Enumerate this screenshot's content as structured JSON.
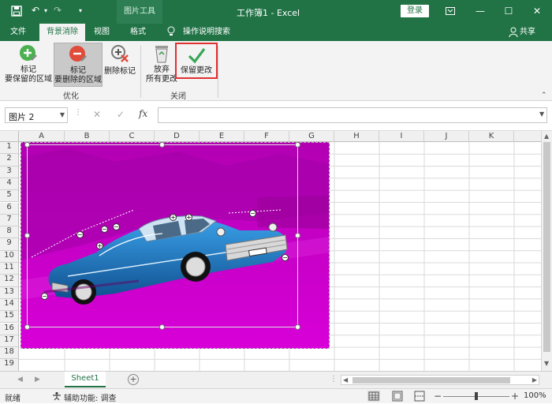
{
  "window": {
    "title": "工作簿1 - Excel",
    "context_tab": "图片工具",
    "login_label": "登录",
    "share_label": "共享",
    "share_icon": "person-icon",
    "controls": {
      "minimize": "—",
      "maximize": "☐",
      "close": "✕"
    }
  },
  "tabs": [
    {
      "label": "文件",
      "active": false
    },
    {
      "label": "背景消除",
      "active": true
    },
    {
      "label": "视图",
      "active": false
    },
    {
      "label": "格式",
      "active": false
    }
  ],
  "tell_me": "操作说明搜索",
  "ribbon": {
    "mark_keep": {
      "line1": "标记",
      "line2": "要保留的区域"
    },
    "mark_remove": {
      "line1": "标记",
      "line2": "要删除的区域"
    },
    "delete_mark": "删除标记",
    "discard": {
      "line1": "放弃",
      "line2": "所有更改"
    },
    "keep_changes": "保留更改",
    "group_optimize": "优化",
    "group_close": "关闭"
  },
  "formula_bar": {
    "name_box": "图片 2",
    "cancel": "✕",
    "confirm": "✓",
    "fx": "fx",
    "formula": ""
  },
  "columns": [
    "A",
    "B",
    "C",
    "D",
    "E",
    "F",
    "G",
    "H",
    "I",
    "J",
    "K"
  ],
  "rows": [
    "1",
    "2",
    "3",
    "4",
    "5",
    "6",
    "7",
    "8",
    "9",
    "10",
    "11",
    "12",
    "13",
    "14",
    "15",
    "16",
    "17",
    "18",
    "19"
  ],
  "sheet_tabs": [
    {
      "label": "Sheet1",
      "active": true
    }
  ],
  "add_sheet": "+",
  "status": {
    "ready": "就绪",
    "accessibility": "辅助功能: 调查",
    "zoom": "100%",
    "zoom_level": 1.0
  },
  "colors": {
    "excel_green": "#217346",
    "removed_area": "#cc00cc",
    "highlight_border": "#e03030"
  }
}
